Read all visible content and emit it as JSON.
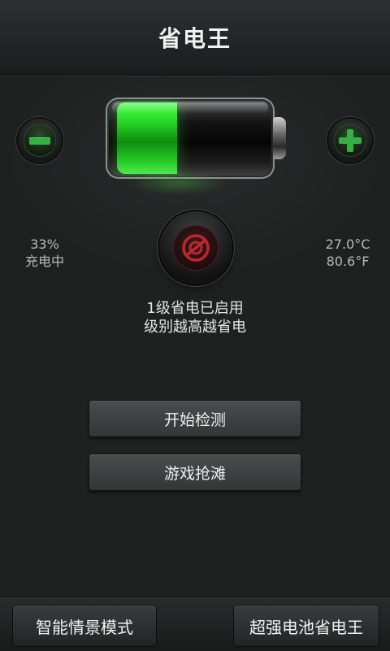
{
  "header": {
    "title": "省电王"
  },
  "battery": {
    "level_fraction": 0.33,
    "fill_color": "#2bdc2b"
  },
  "status": {
    "percent": "33%",
    "state": "充电中",
    "temp_c": "27.0°C",
    "temp_f": "80.6°F"
  },
  "save_mode": {
    "line1": "1级省电已启用",
    "line2": "级别越高越省电",
    "icon_color": "#c0262c"
  },
  "actions": {
    "detect": "开始检测",
    "game": "游戏抢滩"
  },
  "bottom": {
    "scene_mode": "智能情景模式",
    "super_battery": "超强电池省电王"
  }
}
